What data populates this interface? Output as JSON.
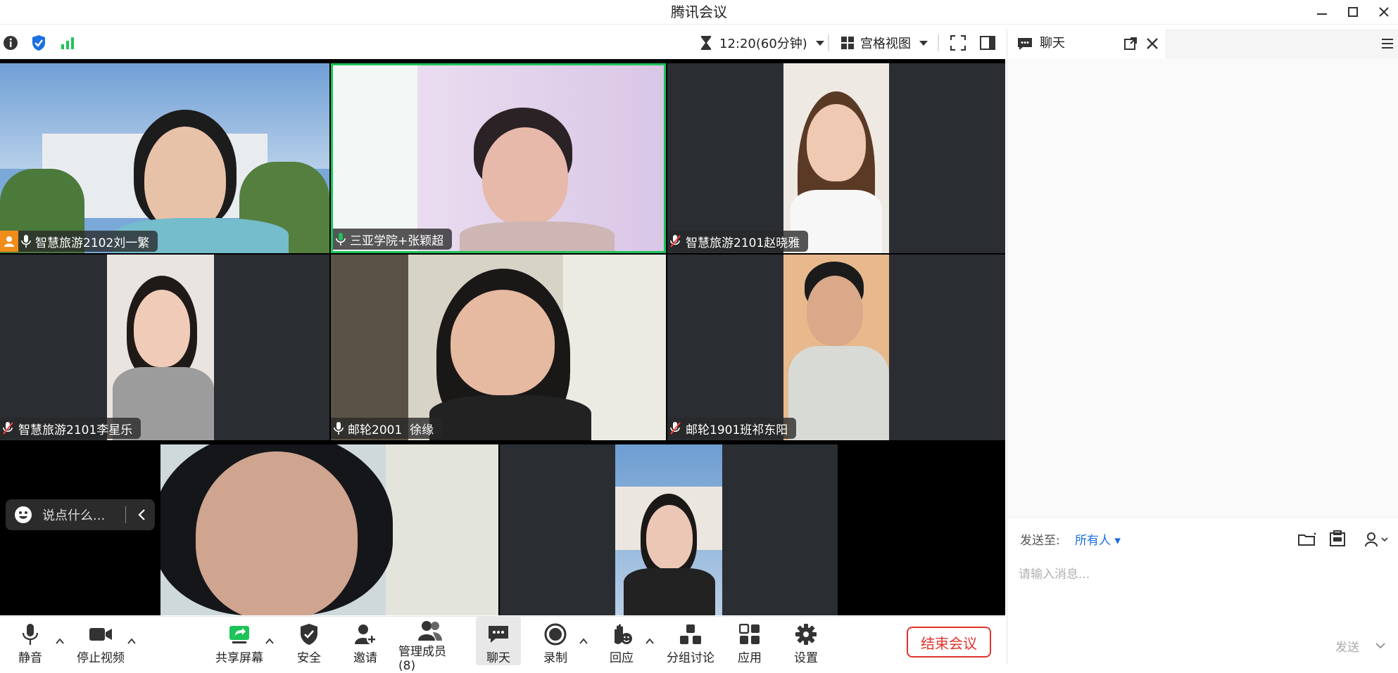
{
  "window": {
    "title": "腾讯会议"
  },
  "toolbar": {
    "timer": "12:20(60分钟)",
    "view_label": "宫格视图"
  },
  "participants": [
    {
      "name": "智慧旅游2102刘一繁",
      "mic": "on"
    },
    {
      "name": "三亚学院+张颖超",
      "mic": "speaking"
    },
    {
      "name": "智慧旅游2101赵晓雅",
      "mic": "muted"
    },
    {
      "name": "智慧旅游2101李星乐",
      "mic": "muted"
    },
    {
      "name": "邮轮2001  徐缘",
      "mic": "on"
    },
    {
      "name": "邮轮1901班祁东阳",
      "mic": "muted"
    }
  ],
  "say_something": {
    "placeholder": "说点什么..."
  },
  "chat": {
    "title": "聊天",
    "send_to_label": "发送至:",
    "send_to_value": "所有人",
    "input_placeholder": "请输入消息...",
    "send_label": "发送"
  },
  "bottom": {
    "mute": "静音",
    "stop_video": "停止视频",
    "share_screen": "共享屏幕",
    "security": "安全",
    "invite": "邀请",
    "manage_members": "管理成员(8)",
    "chat": "聊天",
    "record": "录制",
    "react": "回应",
    "breakout": "分组讨论",
    "apps": "应用",
    "settings": "设置",
    "end_meeting": "结束会议"
  },
  "colors": {
    "accent_green": "#1ec35a",
    "end_red": "#e0342d",
    "link_blue": "#1a6fe3"
  }
}
